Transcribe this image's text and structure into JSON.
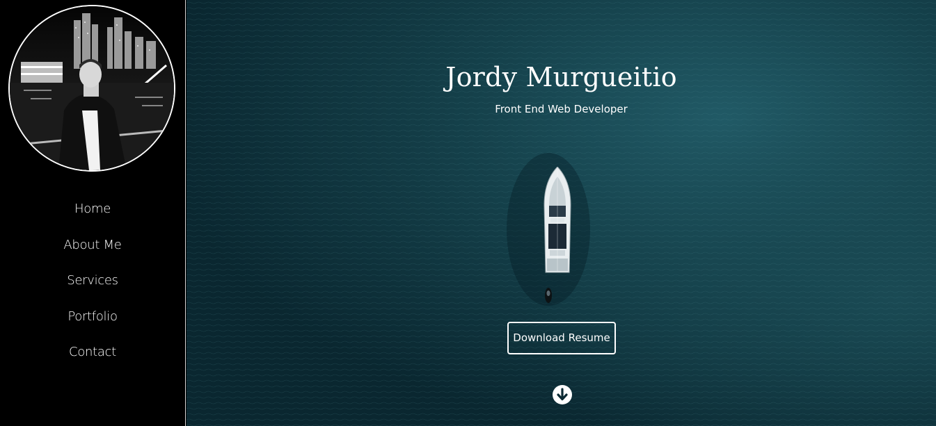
{
  "sidebar": {
    "avatar_alt": "profile photo",
    "items": [
      {
        "label": "Home"
      },
      {
        "label": "About Me"
      },
      {
        "label": "Services"
      },
      {
        "label": "Portfolio"
      },
      {
        "label": "Contact"
      }
    ]
  },
  "hero": {
    "title": "Jordy Murgueitio",
    "subtitle": "Front End Web Developer",
    "resume_button_label": "Download Resume",
    "scroll_icon": "arrow-down-circle-icon"
  },
  "colors": {
    "sidebar_bg": "#000000",
    "sea_dark": "#0b2a33",
    "sea_light": "#1d4f5a",
    "text": "#ffffff"
  }
}
